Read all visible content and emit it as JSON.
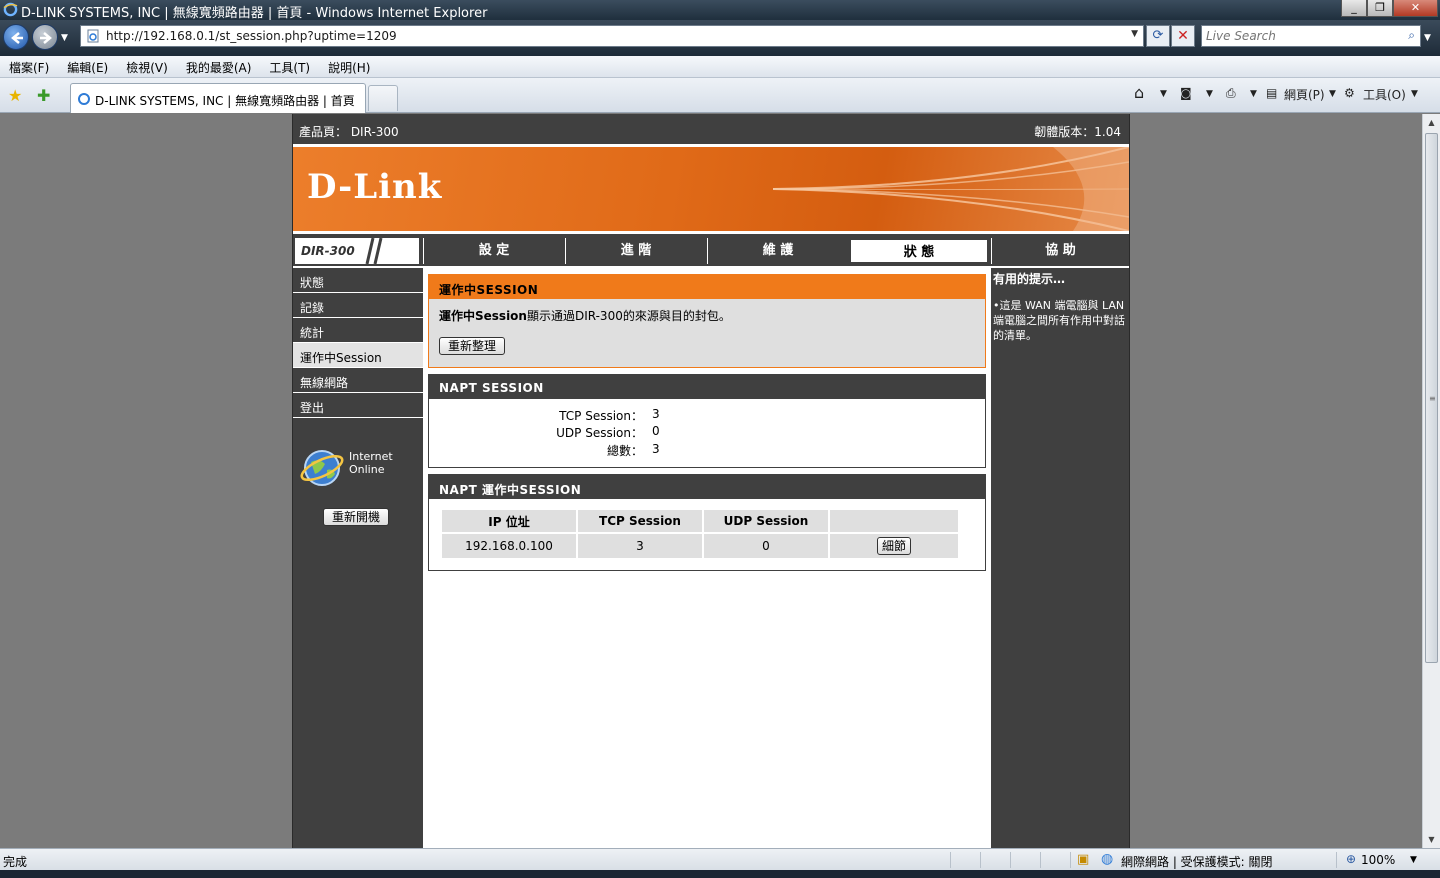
{
  "window": {
    "title": "D-LINK SYSTEMS, INC | 無線寬頻路由器 | 首頁 - Windows Internet Explorer",
    "minimize": "_",
    "restore": "❐",
    "close": "✕"
  },
  "address": {
    "url": "http://192.168.0.1/st_session.php?uptime=1209",
    "search_placeholder": "Live Search"
  },
  "menu": [
    "檔案(F)",
    "編輯(E)",
    "檢視(V)",
    "我的最愛(A)",
    "工具(T)",
    "說明(H)"
  ],
  "tab": {
    "label": "D-LINK SYSTEMS, INC | 無線寬頻路由器 | 首頁"
  },
  "commands": {
    "page": "網頁(P)",
    "tools": "工具(O)"
  },
  "router": {
    "product": "產品頁： DIR-300",
    "firmware": "韌體版本：1.04",
    "logo": "D-Link",
    "model": "DIR-300",
    "tabs": [
      {
        "label": "設 定"
      },
      {
        "label": "進 階"
      },
      {
        "label": "維 護"
      },
      {
        "label": "狀 態"
      },
      {
        "label": "協 助"
      }
    ],
    "left_menu": [
      {
        "label": "狀態"
      },
      {
        "label": "記錄"
      },
      {
        "label": "統計"
      },
      {
        "label": "運作中Session"
      },
      {
        "label": "無線網路"
      },
      {
        "label": "登出"
      }
    ],
    "internet_line1": "Internet",
    "internet_line2": "Online",
    "reboot_label": "重新開機",
    "section1": {
      "title": "運作中SESSION",
      "desc_bold": "運作中Session",
      "desc_rest": "顯示通過DIR-300的來源與目的封包。",
      "refresh_label": "重新整理"
    },
    "section2": {
      "title": "NAPT SESSION",
      "tcp_label": "TCP Session：",
      "tcp_value": "3",
      "udp_label": "UDP Session：",
      "udp_value": "0",
      "total_label": "總數：",
      "total_value": "3"
    },
    "section3": {
      "title": "NAPT 運作中SESSION",
      "headers": [
        "IP 位址",
        "TCP Session",
        "UDP Session",
        ""
      ],
      "rows": [
        {
          "ip": "192.168.0.100",
          "tcp": "3",
          "udp": "0",
          "detail": "細節"
        }
      ]
    },
    "hints": {
      "title": "有用的提示…",
      "text": "•這是 WAN 端電腦與 LAN 端電腦之間所有作用中對話的清單。"
    }
  },
  "status": {
    "done": "完成",
    "zone": "網際網路 | 受保護模式: 關閉",
    "zoom": "100%"
  }
}
